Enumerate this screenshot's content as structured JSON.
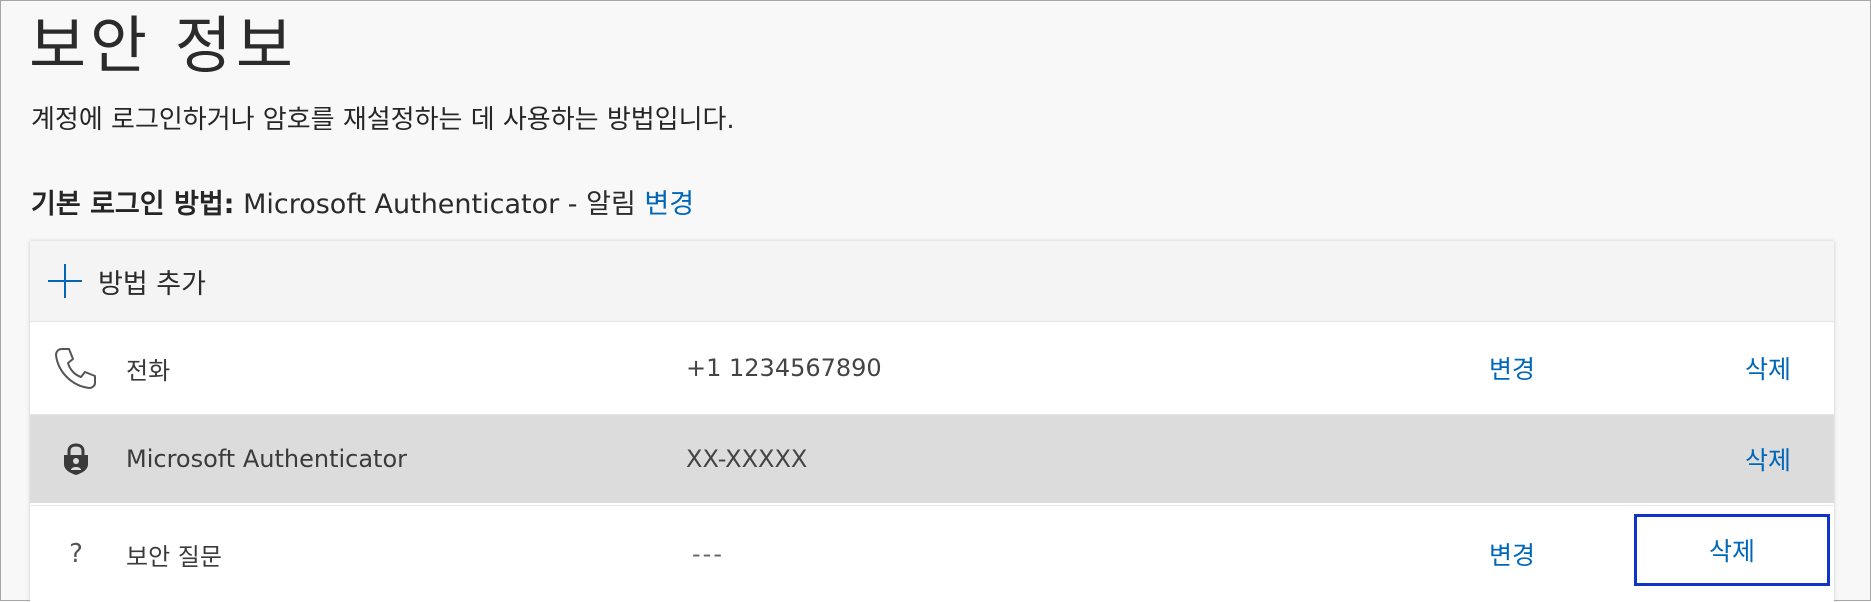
{
  "page": {
    "title": "보안 정보",
    "subtitle": "계정에 로그인하거나 암호를 재설정하는 데 사용하는 방법입니다.",
    "default_method_label": "기본 로그인 방법:",
    "default_method_value": " Microsoft Authenticator - 알림 ",
    "default_method_change": "변경"
  },
  "methods_card": {
    "add_method_label": "방법 추가",
    "rows": [
      {
        "icon": "phone-icon",
        "name": "전화",
        "detail": "+1 1234567890",
        "change": "변경",
        "delete": "삭제"
      },
      {
        "icon": "authenticator-lock-icon",
        "name": "Microsoft Authenticator",
        "detail": "XX-XXXXX",
        "delete": "삭제"
      },
      {
        "icon": "question-icon",
        "icon_glyph": "?",
        "name": "보안 질문",
        "detail": "---",
        "change": "변경",
        "delete": "삭제"
      }
    ]
  },
  "colors": {
    "link": "#0067b8",
    "highlight_row": "#dcdcdc",
    "focus_border": "#1034c8"
  }
}
